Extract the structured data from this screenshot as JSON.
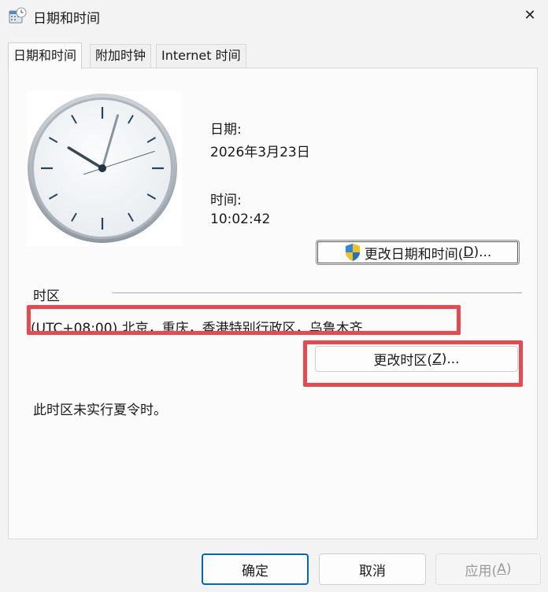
{
  "window": {
    "title": "日期和时间",
    "close_symbol": "✕"
  },
  "tabs": [
    {
      "label": "日期和时间",
      "active": true
    },
    {
      "label": "附加时钟",
      "active": false
    },
    {
      "label": "Internet 时间",
      "active": false
    }
  ],
  "date": {
    "label": "日期:",
    "value": "2026年3月23日"
  },
  "time": {
    "label": "时间:",
    "value": "10:02:42"
  },
  "clock": {
    "hour": 10,
    "minute": 2,
    "second": 42
  },
  "change_datetime_button": {
    "label_prefix": "更改日期和时间(",
    "mnemonic": "D",
    "label_suffix": ")..."
  },
  "timezone": {
    "group_label": "时区",
    "value": "(UTC+08:00) 北京，重庆，香港特别行政区，乌鲁木齐",
    "dst_note": "此时区未实行夏令时。"
  },
  "change_timezone_button": {
    "label_prefix": "更改时区(",
    "mnemonic": "Z",
    "label_suffix": ")..."
  },
  "footer": {
    "ok": "确定",
    "cancel": "取消",
    "apply_prefix": "应用(",
    "apply_mnemonic": "A",
    "apply_suffix": ")"
  },
  "colors": {
    "highlight": "#e8484f",
    "primary_border": "#0067c0"
  }
}
